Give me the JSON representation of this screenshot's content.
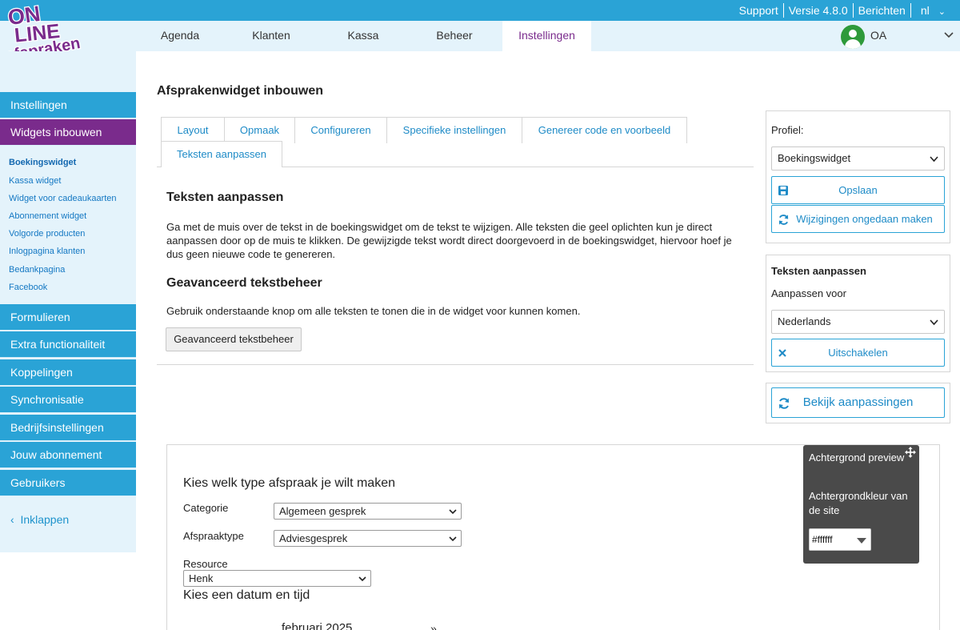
{
  "logo": {
    "text": "ONLINE afspraken .NL"
  },
  "topbar": {
    "support": "Support",
    "version": "Versie 4.8.0",
    "messages": "Berichten",
    "language": "nl"
  },
  "nav": {
    "tabs": [
      "Agenda",
      "Klanten",
      "Kassa",
      "Beheer",
      "Instellingen"
    ],
    "active": "Instellingen",
    "user": "OA"
  },
  "sidebar": {
    "sections": [
      "Instellingen",
      "Widgets inbouwen"
    ],
    "sub_items": [
      "Boekingswidget",
      "Kassa widget",
      "Widget voor cadeaukaarten",
      "Abonnement widget",
      "Volgorde producten",
      "Inlogpagina klanten",
      "Bedankpagina",
      "Facebook"
    ],
    "more_sections": [
      "Formulieren",
      "Extra functionaliteit",
      "Koppelingen",
      "Synchronisatie",
      "Bedrijfsinstellingen",
      "Jouw abonnement",
      "Gebruikers"
    ],
    "collapse": "Inklappen"
  },
  "main": {
    "title": "Afsprakenwidget inbouwen",
    "tabs": [
      "Layout",
      "Opmaak",
      "Configureren",
      "Specifieke instellingen",
      "Genereer code en voorbeeld",
      "Teksten aanpassen"
    ],
    "heading1": "Teksten aanpassen",
    "para1": "Ga met de muis over de tekst in de boekingswidget om de tekst te wijzigen. Alle teksten die geel oplichten kun je direct aanpassen door op de muis te klikken. De gewijzigde tekst wordt direct doorgevoerd in de boekingswidget, hiervoor hoef je dus geen nieuwe code te genereren.",
    "heading2": "Geavanceerd tekstbeheer",
    "para2": "Gebruik onderstaande knop om alle teksten te tonen die in de widget voor kunnen komen.",
    "button": "Geavanceerd tekstbeheer"
  },
  "right": {
    "profile_label": "Profiel:",
    "profile_value": "Boekingswidget",
    "save": "Opslaan",
    "undo": "Wijzigingen ongedaan maken",
    "texts_title": "Teksten aanpassen",
    "adjust_for": "Aanpassen voor",
    "language_value": "Nederlands",
    "disable": "Uitschakelen",
    "view_changes": "Bekijk aanpassingen"
  },
  "preview": {
    "title": "Kies welk type afspraak je wilt maken",
    "category_label": "Categorie",
    "category_value": "Algemeen gesprek",
    "type_label": "Afspraaktype",
    "type_value": "Adviesgesprek",
    "resource_label": "Resource",
    "resource_value": "Henk",
    "date_title": "Kies een datum en tijd",
    "month": "februari 2025",
    "next": "»"
  },
  "overlay": {
    "title": "Achtergrond preview",
    "label": "Achtergrondkleur van de site",
    "value": "#ffffff"
  },
  "colors": {
    "blue": "#2aa3d6",
    "purple": "#7a2b8c",
    "link": "#1e8bc7",
    "light": "#e4f3fb",
    "dark": "#4a4a4a"
  }
}
